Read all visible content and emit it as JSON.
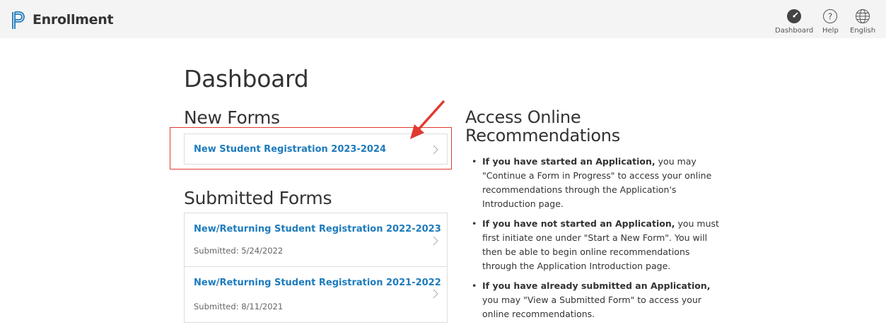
{
  "header": {
    "app_title": "Enrollment",
    "nav": {
      "dashboard": "Dashboard",
      "help": "Help",
      "language": "English"
    }
  },
  "main": {
    "page_title": "Dashboard",
    "new_forms": {
      "title": "New Forms",
      "items": [
        {
          "label": "New Student Registration 2023-2024"
        }
      ]
    },
    "submitted_forms": {
      "title": "Submitted Forms",
      "items": [
        {
          "label": "New/Returning Student Registration 2022-2023",
          "submitted": "Submitted: 5/24/2022"
        },
        {
          "label": "New/Returning Student Registration 2021-2022",
          "submitted": "Submitted: 8/11/2021"
        }
      ]
    }
  },
  "recommendations": {
    "title": "Access Online Recommendations",
    "items": [
      {
        "bold": "If you have started an Application,",
        "text": " you may \"Continue a Form in Progress\" to access your online recommendations through the Application's Introduction page."
      },
      {
        "bold": "If you have not started an Application,",
        "text": " you must first initiate one under \"Start a New Form\". You will then be able to begin online recommendations through the Application Introduction page."
      },
      {
        "bold": "If you have already submitted an Application,",
        "text": " you may \"View a Submitted Form\" to access your online recommendations."
      }
    ]
  },
  "colors": {
    "link": "#1d7bbd",
    "annotation": "#e03a2f",
    "logo": "#1d7bbd"
  },
  "icons": {
    "logo": "powerschool-logo",
    "dashboard": "dashboard-gauge-icon",
    "help": "help-circle-icon",
    "language": "globe-icon",
    "chevron": "chevron-right-icon"
  }
}
